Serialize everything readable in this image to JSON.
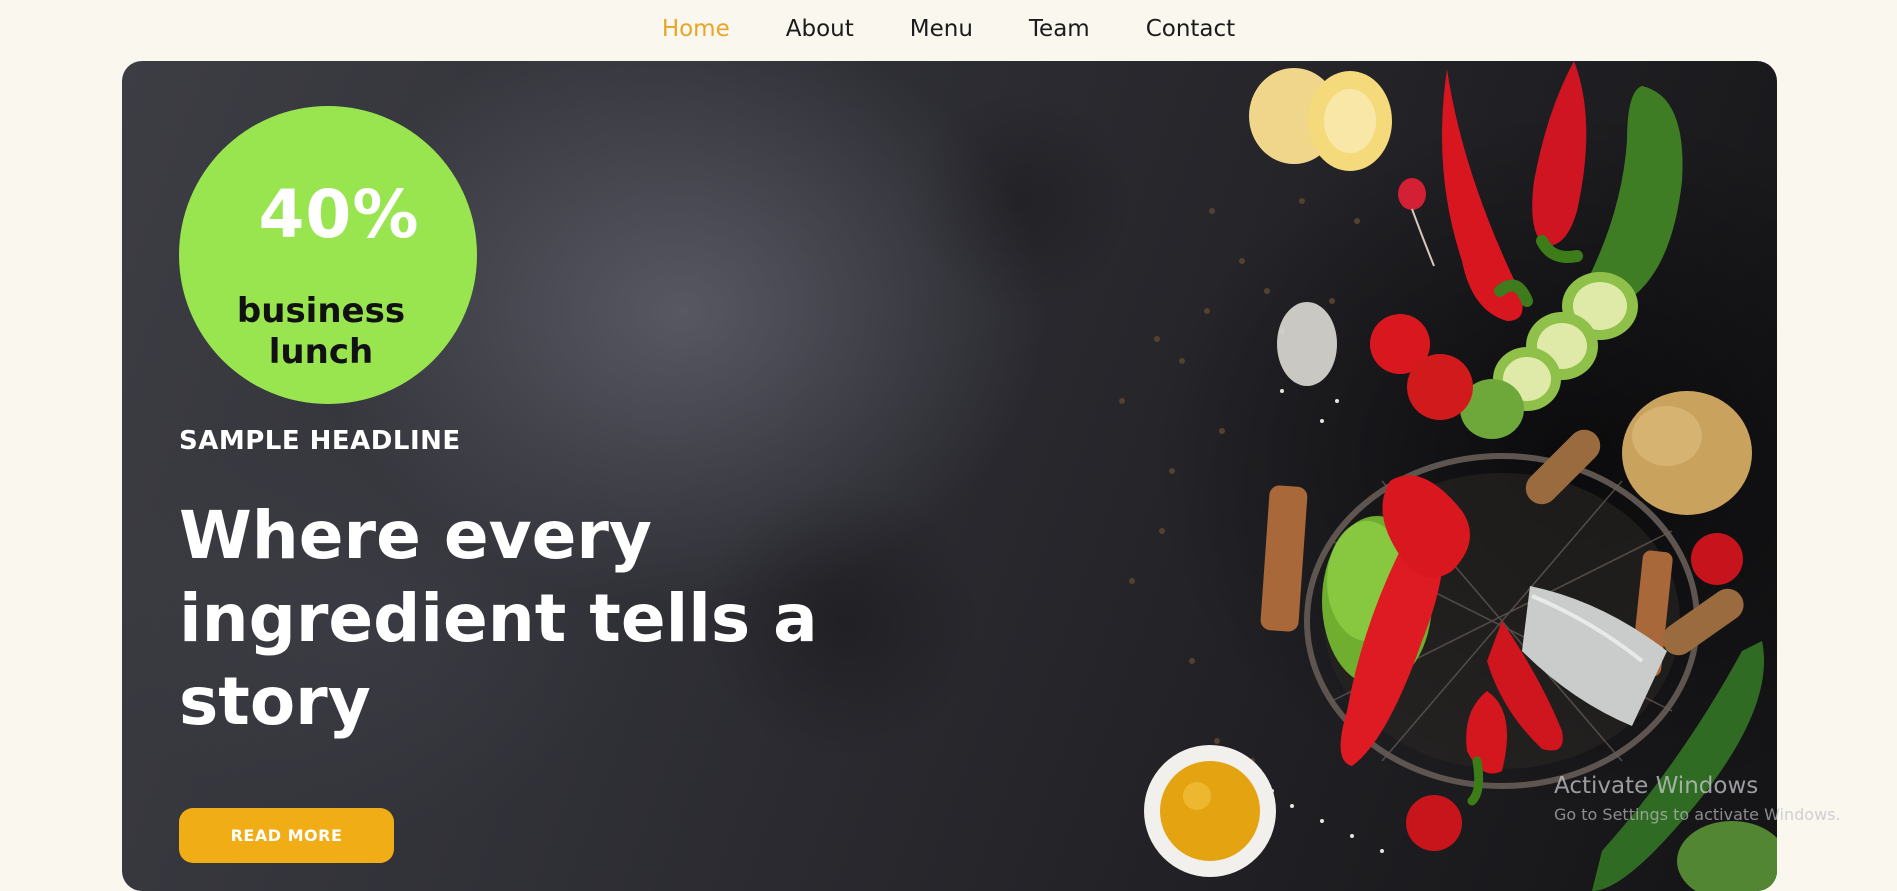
{
  "nav": {
    "items": [
      {
        "label": "Home",
        "active": true
      },
      {
        "label": "About",
        "active": false
      },
      {
        "label": "Menu",
        "active": false
      },
      {
        "label": "Team",
        "active": false
      },
      {
        "label": "Contact",
        "active": false
      }
    ]
  },
  "hero": {
    "promo": {
      "percent": "40%",
      "label_line1": "business",
      "label_line2": "lunch"
    },
    "eyebrow": "SAMPLE HEADLINE",
    "headline": "Where every ingredient tells a story",
    "cta_label": "READ MORE",
    "image_description_icon": "vegetables-image"
  },
  "watermark": {
    "title": "Activate Windows",
    "subtitle": "Go to Settings to activate Windows."
  },
  "colors": {
    "page_bg": "#faf7ee",
    "nav_active": "#e8a52a",
    "promo_green": "#98e550",
    "cta_orange": "#f0ad16",
    "hero_dark": "#2b2b30"
  }
}
